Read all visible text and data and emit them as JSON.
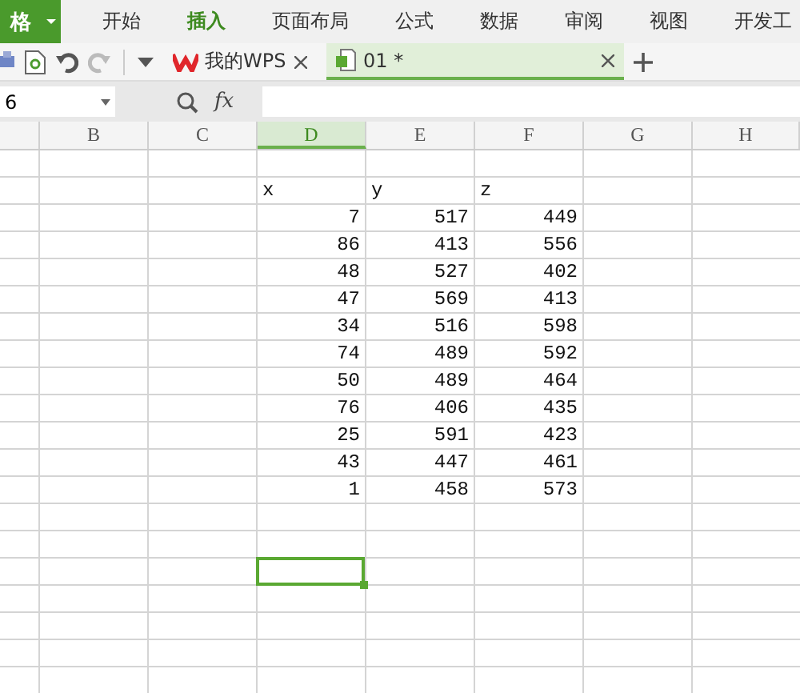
{
  "app_button": {
    "label": "格"
  },
  "ribbon_tabs": [
    {
      "label": "开始",
      "selected": false
    },
    {
      "label": "插入",
      "selected": true
    },
    {
      "label": "页面布局",
      "selected": false
    },
    {
      "label": "公式",
      "selected": false
    },
    {
      "label": "数据",
      "selected": false
    },
    {
      "label": "审阅",
      "selected": false
    },
    {
      "label": "视图",
      "selected": false
    },
    {
      "label": "开发工",
      "selected": false
    }
  ],
  "doc_tabs": [
    {
      "kind": "home",
      "label": "我的WPS",
      "selected": false
    },
    {
      "kind": "sheet",
      "label": "01 *",
      "selected": true
    }
  ],
  "formula_bar": {
    "name_box": "6",
    "fx": "fx"
  },
  "columns": [
    {
      "selected": false
    },
    {
      "label": "B",
      "selected": false
    },
    {
      "label": "C",
      "selected": false
    },
    {
      "label": "D",
      "selected": true
    },
    {
      "label": "E",
      "selected": false
    },
    {
      "label": "F",
      "selected": false
    },
    {
      "label": "G",
      "selected": false
    },
    {
      "label": "H",
      "selected": false
    }
  ],
  "rows": [
    {
      "kind": "blank",
      "selected": false
    },
    {
      "kind": "text",
      "cells": [
        "x",
        "y",
        "z"
      ],
      "selected": false
    },
    {
      "kind": "number",
      "cells": [
        "7",
        "517",
        "449"
      ],
      "selected": false
    },
    {
      "kind": "number",
      "cells": [
        "86",
        "413",
        "556"
      ],
      "selected": false
    },
    {
      "kind": "number",
      "cells": [
        "48",
        "527",
        "402"
      ],
      "selected": false
    },
    {
      "kind": "number",
      "cells": [
        "47",
        "569",
        "413"
      ],
      "selected": false
    },
    {
      "kind": "number",
      "cells": [
        "34",
        "516",
        "598"
      ],
      "selected": false
    },
    {
      "kind": "number",
      "cells": [
        "74",
        "489",
        "592"
      ],
      "selected": false
    },
    {
      "kind": "number",
      "cells": [
        "50",
        "489",
        "464"
      ],
      "selected": false
    },
    {
      "kind": "number",
      "cells": [
        "76",
        "406",
        "435"
      ],
      "selected": false
    },
    {
      "kind": "number",
      "cells": [
        "25",
        "591",
        "423"
      ],
      "selected": false
    },
    {
      "kind": "number",
      "cells": [
        "43",
        "447",
        "461"
      ],
      "selected": false
    },
    {
      "kind": "number",
      "cells": [
        "1",
        "458",
        "573"
      ],
      "selected": false
    },
    {
      "kind": "blank",
      "selected": false
    },
    {
      "kind": "blank",
      "selected": false
    },
    {
      "kind": "blank",
      "selected": true
    },
    {
      "kind": "blank",
      "selected": false
    },
    {
      "kind": "blank",
      "selected": false
    },
    {
      "kind": "blank",
      "selected": false
    },
    {
      "kind": "blank",
      "selected": false
    }
  ]
}
